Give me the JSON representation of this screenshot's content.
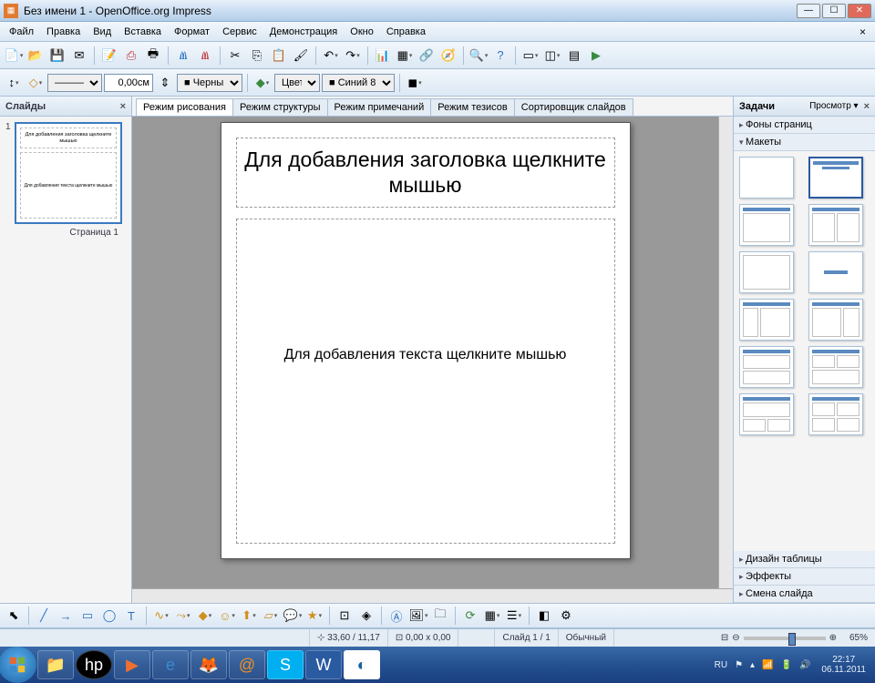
{
  "window": {
    "title": "Без имени 1 - OpenOffice.org Impress"
  },
  "menu": {
    "items": [
      "Файл",
      "Правка",
      "Вид",
      "Вставка",
      "Формат",
      "Сервис",
      "Демонстрация",
      "Окно",
      "Справка"
    ]
  },
  "toolbar2": {
    "size_value": "0,00см",
    "color_label": "Черный",
    "color2_label": "Цвет",
    "color3_label": "Синий 8"
  },
  "slides_panel": {
    "title": "Слайды",
    "items": [
      {
        "num": "1",
        "title": "Для добавления заголовка щелкните мышью",
        "body": "Для добавления текста щелкните мышью"
      }
    ],
    "caption": "Страница 1"
  },
  "view_tabs": [
    "Режим рисования",
    "Режим структуры",
    "Режим примечаний",
    "Режим тезисов",
    "Сортировщик слайдов"
  ],
  "slide": {
    "title_placeholder": "Для добавления заголовка щелкните мышью",
    "body_placeholder": "Для добавления текста щелкните мышью"
  },
  "tasks_panel": {
    "title": "Задачи",
    "view_label": "Просмотр ▾",
    "groups": {
      "page_backgrounds": "Фоны страниц",
      "layouts": "Макеты",
      "table_design": "Дизайн таблицы",
      "effects": "Эффекты",
      "transition": "Смена слайда"
    },
    "layouts": [
      {
        "id": "blank",
        "sel": false
      },
      {
        "id": "title-content",
        "sel": true
      },
      {
        "id": "title-only",
        "sel": false
      },
      {
        "id": "title-two-col",
        "sel": false
      },
      {
        "id": "content-only",
        "sel": false
      },
      {
        "id": "title-centered",
        "sel": false
      },
      {
        "id": "title-left-right",
        "sel": false
      },
      {
        "id": "title-big-small",
        "sel": false
      },
      {
        "id": "two-row",
        "sel": false
      },
      {
        "id": "title-two-row",
        "sel": false
      },
      {
        "id": "title-3cell",
        "sel": false
      },
      {
        "id": "title-4cell",
        "sel": false
      }
    ]
  },
  "status": {
    "pos": "33,60 / 11,17",
    "size": "0,00 x 0,00",
    "slide": "Слайд 1 / 1",
    "mode": "Обычный",
    "zoom": "65%"
  },
  "taskbar": {
    "lang": "RU",
    "time": "22:17",
    "date": "06.11.2011"
  },
  "icons": {
    "pos_icon": "⊹",
    "size_icon": "⊡"
  }
}
